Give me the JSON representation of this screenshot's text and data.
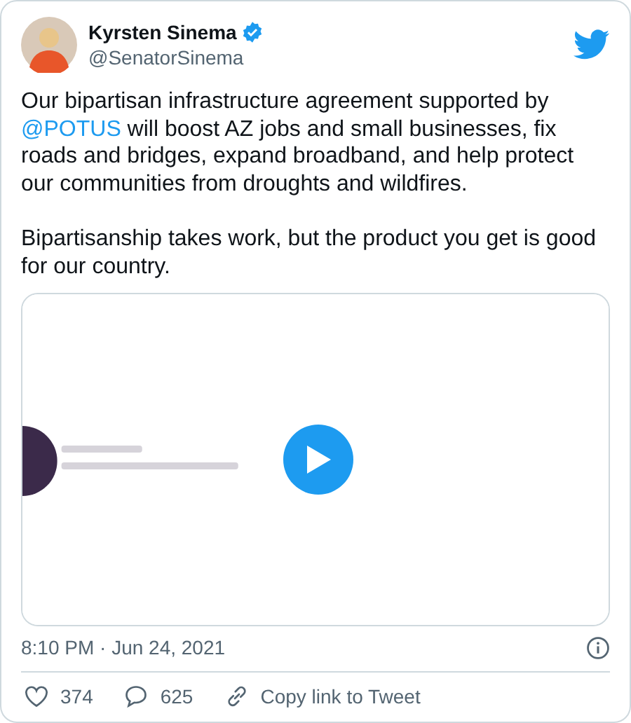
{
  "author": {
    "name": "Kyrsten Sinema",
    "verified": true,
    "handle": "@SenatorSinema"
  },
  "paragraphs": [
    {
      "before": "Our bipartisan infrastructure agreement supported by ",
      "mention": "@POTUS",
      "after": " will boost AZ jobs and small businesses, fix roads and bridges, expand broadband, and help protect our communities from droughts and wildfires."
    },
    {
      "before": "Bipartisanship takes work, but the product you get is good for our country."
    }
  ],
  "timestamp": "8:10 PM · Jun 24, 2021",
  "actions": [
    {
      "kind": "like",
      "label": "374"
    },
    {
      "kind": "reply",
      "label": "625"
    },
    {
      "kind": "copy-link",
      "label": "Copy link to Tweet"
    }
  ]
}
